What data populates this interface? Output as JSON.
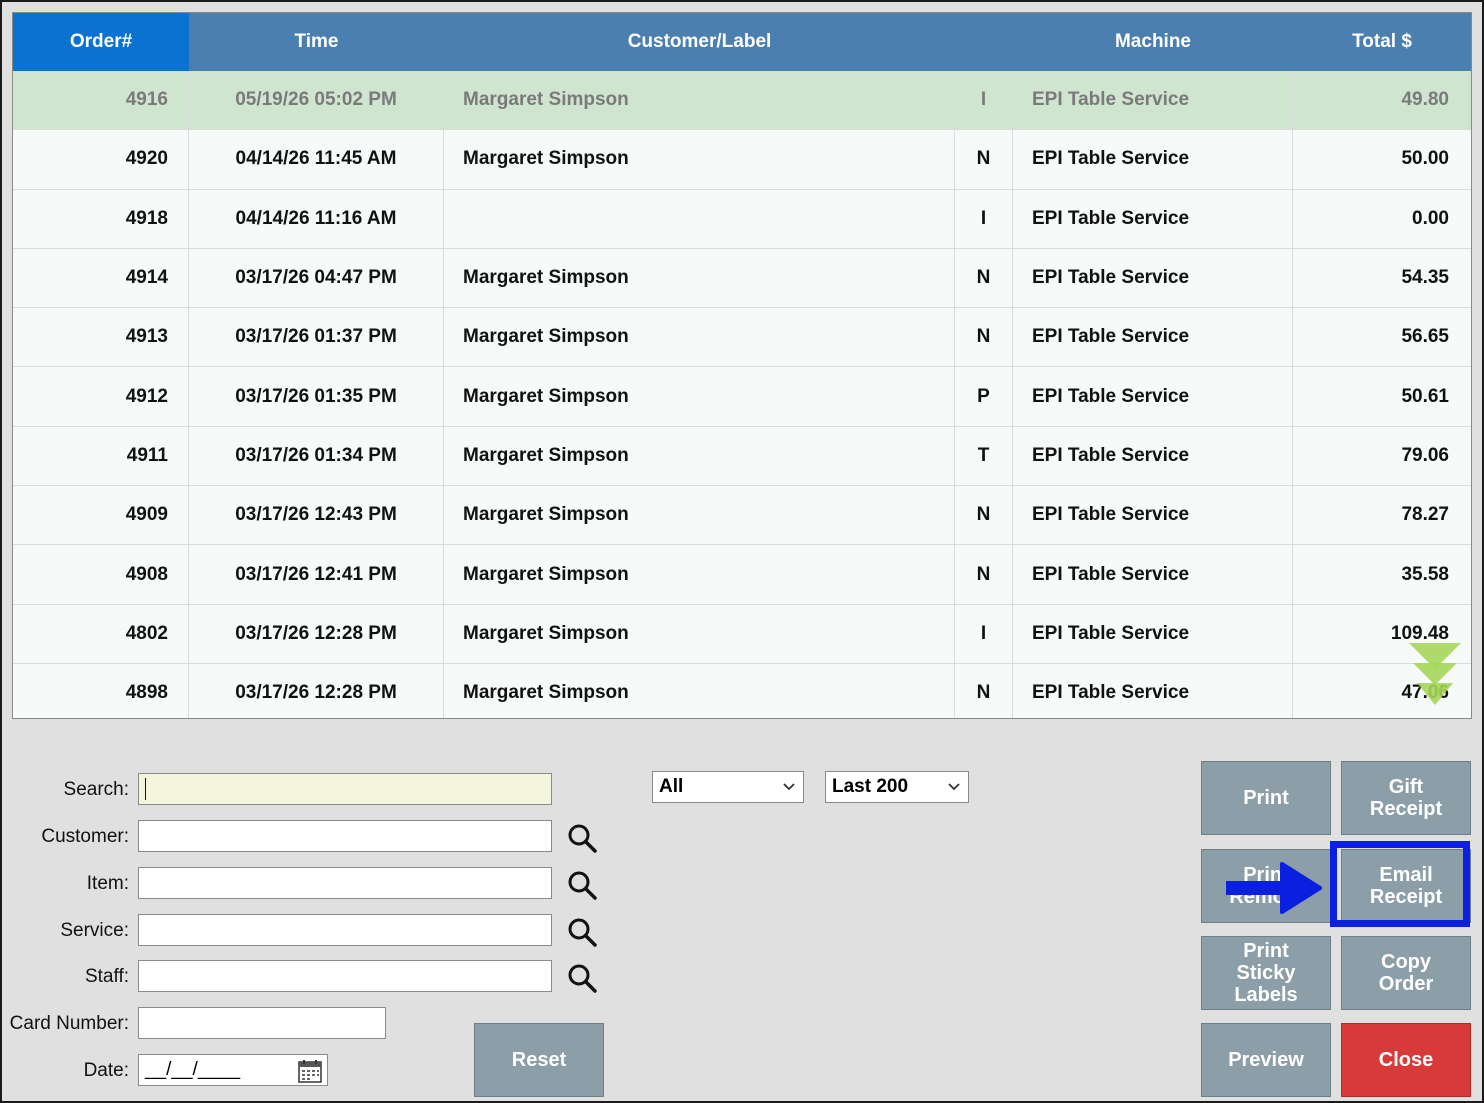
{
  "table": {
    "headers": [
      "Order#",
      "Time",
      "Customer/Label",
      "",
      "Machine",
      "Total $"
    ],
    "rows": [
      {
        "order": "4916",
        "time": "05/19/26 05:02 PM",
        "customer": "Margaret Simpson",
        "code": "I",
        "machine": "EPI Table Service",
        "total": "49.80",
        "selected": true
      },
      {
        "order": "4920",
        "time": "04/14/26 11:45 AM",
        "customer": "Margaret Simpson",
        "code": "N",
        "machine": "EPI Table Service",
        "total": "50.00"
      },
      {
        "order": "4918",
        "time": "04/14/26 11:16 AM",
        "customer": "",
        "code": "I",
        "machine": "EPI Table Service",
        "total": "0.00"
      },
      {
        "order": "4914",
        "time": "03/17/26 04:47 PM",
        "customer": "Margaret Simpson",
        "code": "N",
        "machine": "EPI Table Service",
        "total": "54.35"
      },
      {
        "order": "4913",
        "time": "03/17/26 01:37 PM",
        "customer": "Margaret Simpson",
        "code": "N",
        "machine": "EPI Table Service",
        "total": "56.65"
      },
      {
        "order": "4912",
        "time": "03/17/26 01:35 PM",
        "customer": "Margaret Simpson",
        "code": "P",
        "machine": "EPI Table Service",
        "total": "50.61"
      },
      {
        "order": "4911",
        "time": "03/17/26 01:34 PM",
        "customer": "Margaret Simpson",
        "code": "T",
        "machine": "EPI Table Service",
        "total": "79.06"
      },
      {
        "order": "4909",
        "time": "03/17/26 12:43 PM",
        "customer": "Margaret Simpson",
        "code": "N",
        "machine": "EPI Table Service",
        "total": "78.27"
      },
      {
        "order": "4908",
        "time": "03/17/26 12:41 PM",
        "customer": "Margaret Simpson",
        "code": "N",
        "machine": "EPI Table Service",
        "total": "35.58"
      },
      {
        "order": "4802",
        "time": "03/17/26 12:28 PM",
        "customer": "Margaret Simpson",
        "code": "I",
        "machine": "EPI Table Service",
        "total": "109.48"
      },
      {
        "order": "4898",
        "time": "03/17/26 12:28 PM",
        "customer": "Margaret Simpson",
        "code": "N",
        "machine": "EPI Table Service",
        "total": "47.06"
      }
    ]
  },
  "filters": {
    "search_label": "Search:",
    "search_value": "",
    "customer_label": "Customer:",
    "item_label": "Item:",
    "service_label": "Service:",
    "staff_label": "Staff:",
    "card_label": "Card Number:",
    "date_label": "Date:",
    "date_value": "__/__/____",
    "type_select": "All",
    "range_select": "Last 200"
  },
  "icons": {
    "lookup": "magnifier-icon",
    "calendar": "calendar-icon",
    "scroll": "scroll-down-icon",
    "pointer": "arrow-right-icon"
  },
  "buttons": {
    "reset": "Reset",
    "print": "Print",
    "gift_receipt": "Gift Receipt",
    "print_remote": "Print Remote",
    "email_receipt": "Email Receipt",
    "print_sticky": "Print Sticky Labels",
    "copy_order": "Copy Order",
    "preview": "Preview",
    "close": "Close"
  },
  "colors": {
    "header": "#4a7fb0",
    "header_active": "#0a72d0",
    "selected_row": "#cfe5cf",
    "button": "#8c9fa8",
    "close_button": "#d83a3a",
    "highlight": "#0a1fe0",
    "scroll_arrow": "#a6d65a"
  }
}
